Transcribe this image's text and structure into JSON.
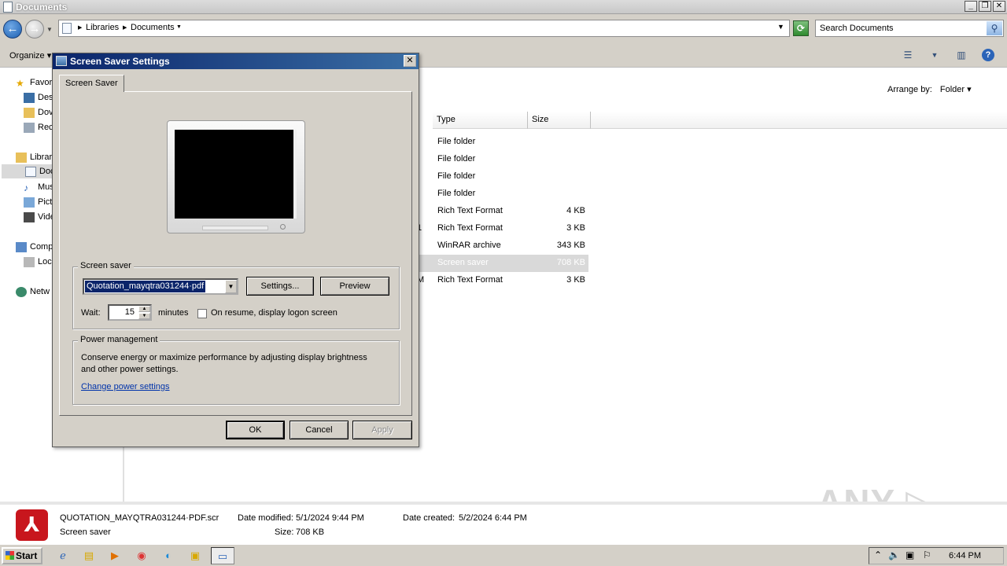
{
  "explorer": {
    "title": "Documents",
    "window_buttons": {
      "minimize": "_",
      "restore": "❐",
      "close": "✕"
    },
    "breadcrumb": [
      "Libraries",
      "Documents"
    ],
    "search_placeholder": "Search Documents",
    "organize_label": "Organize",
    "arrange_label": "Arrange by:",
    "arrange_value": "Folder",
    "columns": {
      "type": "Type",
      "size": "Size"
    },
    "nav_items": [
      {
        "label": "Favor",
        "icon": "star-icon"
      },
      {
        "label": "Des",
        "icon": "desktop-icon"
      },
      {
        "label": "Dov",
        "icon": "downloads-icon"
      },
      {
        "label": "Rec",
        "icon": "recent-places-icon"
      },
      {
        "label": "Librar",
        "icon": "libraries-icon"
      },
      {
        "label": "Doc",
        "icon": "documents-icon"
      },
      {
        "label": "Mus",
        "icon": "music-icon"
      },
      {
        "label": "Pict",
        "icon": "pictures-icon"
      },
      {
        "label": "Vide",
        "icon": "videos-icon"
      },
      {
        "label": "Comp",
        "icon": "computer-icon"
      },
      {
        "label": "Loc",
        "icon": "local-disk-icon"
      },
      {
        "label": "Netw",
        "icon": "network-icon"
      }
    ],
    "rows": [
      {
        "mark": "",
        "type": "File folder",
        "size": ""
      },
      {
        "mark": "",
        "type": "File folder",
        "size": ""
      },
      {
        "mark": "",
        "type": "File folder",
        "size": ""
      },
      {
        "mark": "",
        "type": "File folder",
        "size": ""
      },
      {
        "mark": "",
        "type": "Rich Text Format",
        "size": "4 KB"
      },
      {
        "mark": "1",
        "type": "Rich Text Format",
        "size": "3 KB"
      },
      {
        "mark": "",
        "type": "WinRAR archive",
        "size": "343 KB"
      },
      {
        "mark": "",
        "type": "Screen saver",
        "size": "708 KB"
      },
      {
        "mark": "M",
        "type": "Rich Text Format",
        "size": "3 KB"
      }
    ],
    "details": {
      "filename": "QUOTATION_MAYQTRA031244·PDF.scr",
      "date_modified_label": "Date modified:",
      "date_modified": "5/1/2024 9:44 PM",
      "date_created_label": "Date created:",
      "date_created": "5/2/2024 6:44 PM",
      "file_type": "Screen saver",
      "size_label": "Size:",
      "size": "708 KB"
    },
    "watermark": "ANY ▷ RUN"
  },
  "dialog": {
    "title": "Screen Saver Settings",
    "tab": "Screen Saver",
    "screensaver_group": "Screen saver",
    "selected_saver": "Quotation_mayqtra031244·pdf",
    "settings_button": "Settings...",
    "preview_button": "Preview",
    "wait_label": "Wait:",
    "wait_value": "15",
    "minutes_label": "minutes",
    "resume_label": "On resume, display logon screen",
    "resume_checked": false,
    "power_group": "Power management",
    "power_text": "Conserve energy or maximize performance by adjusting display brightness and other power settings.",
    "power_link": "Change power settings",
    "ok": "OK",
    "cancel": "Cancel",
    "apply": "Apply"
  },
  "taskbar": {
    "start": "Start",
    "apps": [
      "ie-icon",
      "explorer-icon",
      "media-player-icon",
      "chrome-icon",
      "edge-icon",
      "outlook-icon",
      "screen-saver-icon"
    ],
    "clock": "6:44 PM"
  },
  "colors": {
    "title_gradient_start": "#0a246a",
    "title_gradient_end": "#3a6ea5",
    "link": "#0033aa",
    "pdf_red": "#c8161d"
  }
}
